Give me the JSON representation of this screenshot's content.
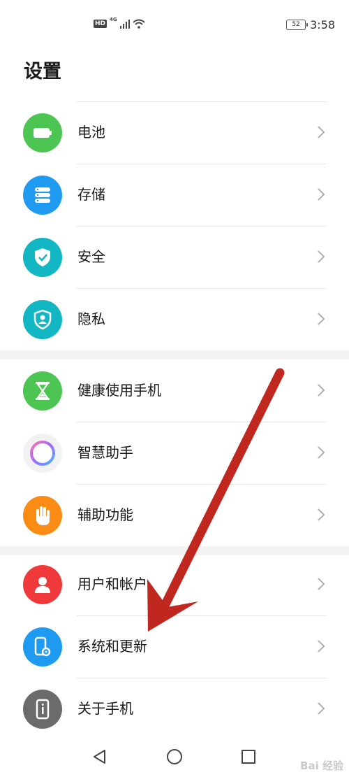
{
  "status_bar": {
    "hd": "HD",
    "network": "4G",
    "battery": "52",
    "time": "3:58"
  },
  "title": "设置",
  "groups": [
    {
      "items": [
        {
          "label": "电池",
          "icon": "battery-icon",
          "color": "#4cc552"
        },
        {
          "label": "存储",
          "icon": "storage-icon",
          "color": "#1e9bf0"
        },
        {
          "label": "安全",
          "icon": "security-shield-icon",
          "color": "#13b6c3"
        },
        {
          "label": "隐私",
          "icon": "privacy-shield-icon",
          "color": "#13b6c3"
        }
      ]
    },
    {
      "items": [
        {
          "label": "健康使用手机",
          "icon": "hourglass-icon",
          "color": "#4cc552"
        },
        {
          "label": "智慧助手",
          "icon": "assistant-ring-icon",
          "color": "#f2f2f2"
        },
        {
          "label": "辅助功能",
          "icon": "hand-icon",
          "color": "#fa8c16"
        }
      ]
    },
    {
      "items": [
        {
          "label": "用户和帐户",
          "icon": "user-icon",
          "color": "#f0393a"
        },
        {
          "label": "系统和更新",
          "icon": "system-update-icon",
          "color": "#1e9bf0"
        },
        {
          "label": "关于手机",
          "icon": "phone-info-icon",
          "color": "#6b6b6b"
        }
      ]
    }
  ],
  "watermark": "Bai 经验",
  "annotation_color": "#c0281f"
}
